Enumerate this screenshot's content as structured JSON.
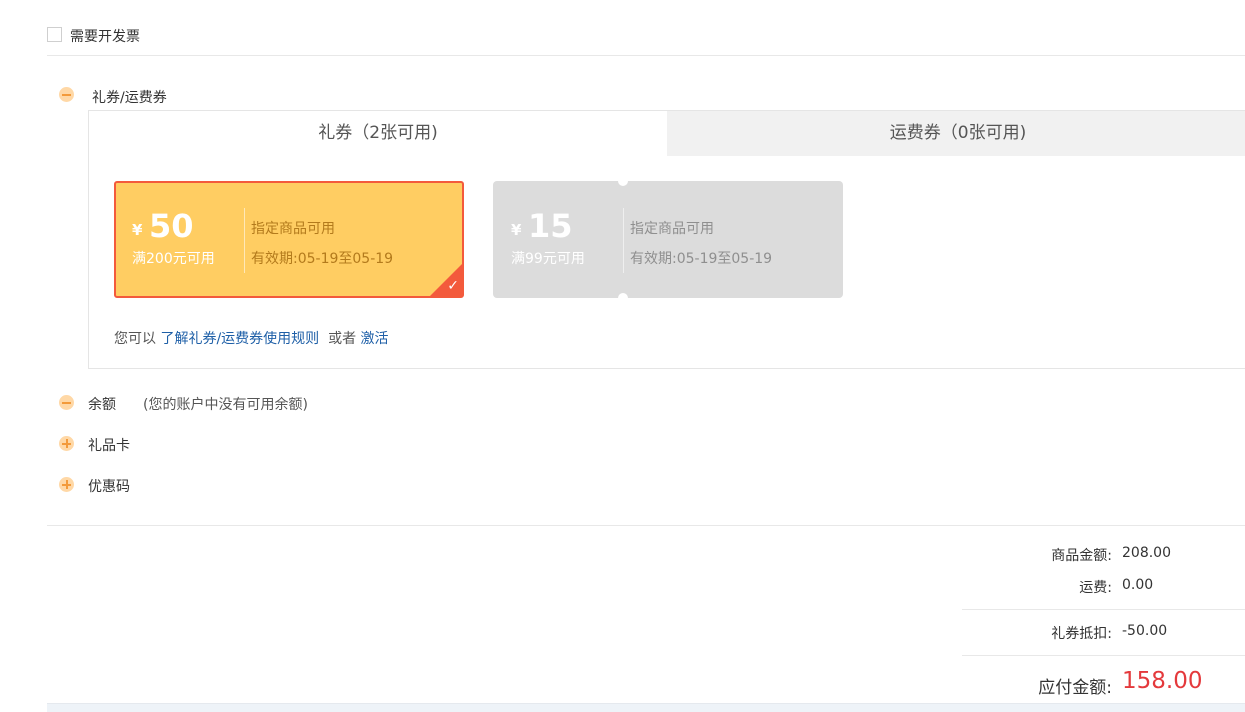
{
  "invoice": {
    "label": "需要开发票",
    "checked": false
  },
  "sections": {
    "coupons": {
      "label": "礼券/运费券"
    },
    "balance": {
      "label": "余额",
      "note": "(您的账户中没有可用余额)"
    },
    "gift_card": {
      "label": "礼品卡"
    },
    "promo_code": {
      "label": "优惠码"
    }
  },
  "tabs": [
    {
      "label": "礼券（2张可用)",
      "active": true
    },
    {
      "label": "运费券（0张可用)",
      "active": false
    }
  ],
  "coupons": [
    {
      "currency": "¥",
      "amount": "50",
      "condition": "满200元可用",
      "scope": "指定商品可用",
      "validity": "有效期:05-19至05-19",
      "selected": true
    },
    {
      "currency": "¥",
      "amount": "15",
      "condition": "满99元可用",
      "scope": "指定商品可用",
      "validity": "有效期:05-19至05-19",
      "selected": false
    }
  ],
  "rules": {
    "prefix": "您可以",
    "rules_link": "了解礼券/运费券使用规则",
    "middle": "或者",
    "activate_link": "激活"
  },
  "summary": {
    "goods_label": "商品金额:",
    "goods_value": "208.00",
    "shipping_label": "运费:",
    "shipping_value": "0.00",
    "discount_label": "礼券抵扣:",
    "discount_value": "-50.00",
    "total_label": "应付金额:",
    "total_value": "158.00"
  },
  "colors": {
    "accent": "#e4393c",
    "coupon_active_bg": "#ffcd62",
    "coupon_border": "#f35a3c",
    "link": "#1e5fa7"
  }
}
